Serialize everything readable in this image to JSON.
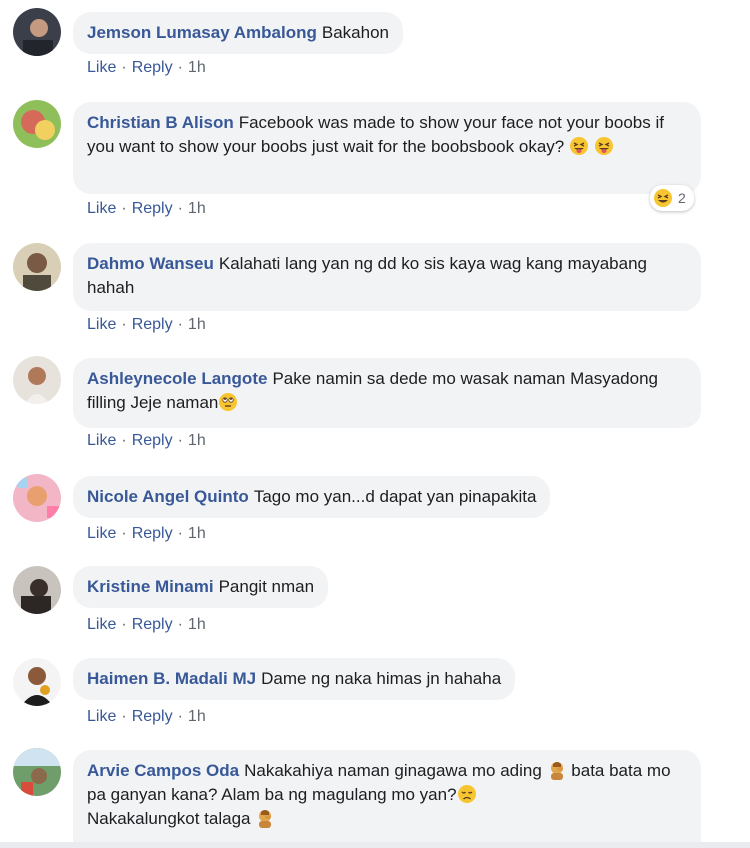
{
  "comments": [
    {
      "author": "Jemson Lumasay Ambalong",
      "text": "Bakahon",
      "like": "Like",
      "reply": "Reply",
      "sep": "·",
      "time": "1h"
    },
    {
      "author": "Christian B Alison",
      "text": "Facebook was made to show your face not your boobs if you want to show your boobs just wait for the boobsbook okay?",
      "like": "Like",
      "reply": "Reply",
      "sep": "·",
      "time": "1h",
      "reaction_count": "2"
    },
    {
      "author": "Dahmo Wanseu",
      "text": "Kalahati lang yan ng dd ko sis kaya wag kang mayabang hahah",
      "like": "Like",
      "reply": "Reply",
      "sep": "·",
      "time": "1h"
    },
    {
      "author": "Ashleynecole Langote",
      "text": "Pake namin sa dede mo wasak naman Masyadong filling Jeje naman",
      "like": "Like",
      "reply": "Reply",
      "sep": "·",
      "time": "1h"
    },
    {
      "author": "Nicole Angel Quinto",
      "text": "Tago mo yan...d dapat yan pinapakita",
      "like": "Like",
      "reply": "Reply",
      "sep": "·",
      "time": "1h"
    },
    {
      "author": "Kristine Minami",
      "text": "Pangit nman",
      "like": "Like",
      "reply": "Reply",
      "sep": "·",
      "time": "1h"
    },
    {
      "author": "Haimen B. Madali MJ",
      "text": "Dame ng naka himas jn hahaha",
      "like": "Like",
      "reply": "Reply",
      "sep": "·",
      "time": "1h"
    },
    {
      "author": "Arvie Campos Oda",
      "text_1": "Nakakahiya naman ginagawa mo ading",
      "text_2": "bata bata mo pa ganyan kana? Alam ba ng magulang mo yan?",
      "text_3": "Nakakalungkot talaga"
    }
  ],
  "colors": {
    "link": "#385898",
    "bubble": "#f2f3f5",
    "meta": "#606770"
  }
}
